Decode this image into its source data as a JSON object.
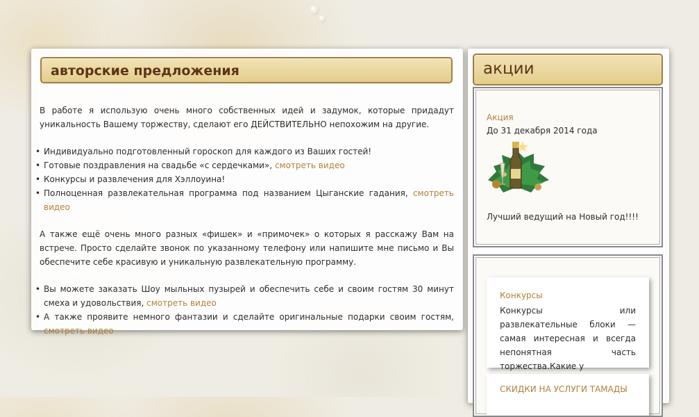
{
  "main": {
    "title": "авторские предложения",
    "intro": "В работе я использую очень много собственных идей и задумок, которые придадут уникальность Вашему торжеству, сделают его ДЕЙСТВИТЕЛЬНО непохожим на другие.",
    "list1": [
      {
        "text": "Индивидуально подготовленный гороскоп для каждого из Ваших гостей!",
        "link": ""
      },
      {
        "text": "Готовые поздравления на свадьбе «с сердечками», ",
        "link": "смотреть видео"
      },
      {
        "text": "Конкурсы и развлечения для Хэллоуина!",
        "link": ""
      },
      {
        "text": "Полноценная развлекательная программа под названием Цыганские гадания, ",
        "link": "смотреть видео"
      }
    ],
    "para2": "А также ещё очень много разных «фишек» и «примочек» о которых я расскажу Вам на встрече. Просто сделайте звонок по указанному телефону или напишите мне письмо и Вы обеспечите себе красивую и уникальную развлекательную программу.",
    "list2": [
      {
        "text": "Вы можете заказать Шоу мыльных пузырей и обеспечить себе и своим гостям 30 минут смеха и удовольствия, ",
        "link": "смотреть видео"
      },
      {
        "text": "А также проявите немного фантазии и сделайте оригинальные подарки своим гостям, ",
        "link": "смотреть видео"
      }
    ]
  },
  "sidebar": {
    "title": "акции",
    "promo": {
      "title": "Акция",
      "date": "До 31 декабря 2014 года",
      "description": "Лучший ведущий на Новый год!!!!"
    },
    "cards": [
      {
        "title": "Конкурсы",
        "text": "Конкурсы или развлекательные блоки — самая интересная и всегда непонятная часть торжества.Какие у"
      },
      {
        "title": "СКИДКИ НА УСЛУГИ ТАМАДЫ",
        "text": ""
      }
    ]
  },
  "colors": {
    "link": "#b0803a",
    "heading": "#5b3518",
    "header_bg": "#e9d69c",
    "header_border": "#9d7f45"
  }
}
